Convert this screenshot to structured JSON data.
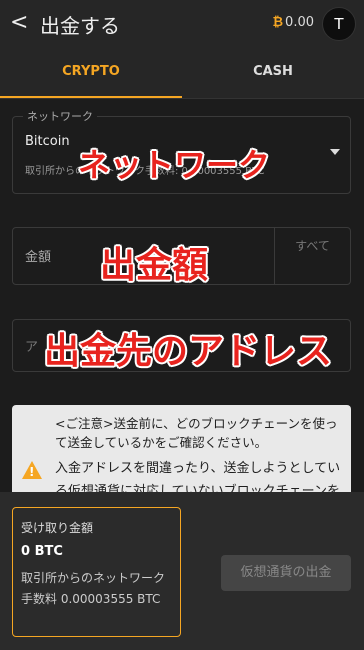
{
  "header": {
    "back_label": "<",
    "title": "出金する",
    "balance_icon": "bitcoin-icon",
    "balance": "0.00",
    "avatar_letter": "T"
  },
  "tabs": [
    {
      "label": "CRYPTO",
      "active": true
    },
    {
      "label": "CASH",
      "active": false
    }
  ],
  "network": {
    "legend": "ネットワーク",
    "coin": "Bitcoin",
    "fee_text": "取引所からのネットワーク手数料: 0.00003555 BTC",
    "overlay": "ネットワーク"
  },
  "amount": {
    "label": "金額",
    "all_button": "すべて",
    "overlay": "出金額"
  },
  "address": {
    "label": "ア",
    "overlay": "出金先のアドレス"
  },
  "notice": {
    "icon": "warning-icon",
    "paragraph1": "<ご注意>送金前に、どのブロックチェーンを使って送金しているかをご確認ください。",
    "paragraph2": "入金アドレスを間違ったり、送金しようとしている仮想通貨に対応していないブロックチェーンを使用したりすると、資産を失う可能性があります。"
  },
  "footer": {
    "receive_label": "受け取り金額",
    "receive_value": "0 BTC",
    "fee_text": "取引所からのネットワーク手数料 0.00003555 BTC",
    "withdraw_button": "仮想通貨の出金"
  },
  "colors": {
    "accent": "#f5a623",
    "background": "#1c1c1c",
    "overlay_red": "#e8231e"
  }
}
